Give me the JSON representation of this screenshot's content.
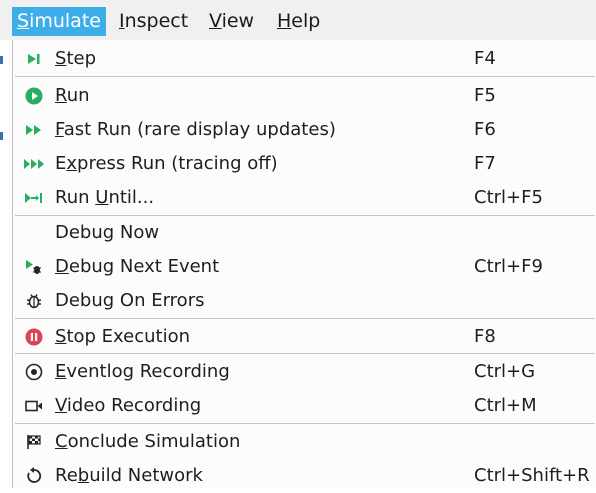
{
  "menubar": [
    {
      "label": "Simulate",
      "mnemonic_index": 0,
      "active": true
    },
    {
      "label": "Inspect",
      "mnemonic_index": 0,
      "active": false
    },
    {
      "label": "View",
      "mnemonic_index": 0,
      "active": false
    },
    {
      "label": "Help",
      "mnemonic_index": 0,
      "active": false
    }
  ],
  "menu": {
    "items": [
      {
        "label": "Step",
        "mnemonic_index": 0,
        "shortcut": "F4",
        "icon": "step-icon"
      },
      {
        "label": "Run",
        "mnemonic_index": 0,
        "shortcut": "F5",
        "icon": "run-icon"
      },
      {
        "label": "Fast Run (rare display updates)",
        "mnemonic_index": 0,
        "shortcut": "F6",
        "icon": "fast-run-icon"
      },
      {
        "label": "Express Run (tracing off)",
        "mnemonic_index": 1,
        "shortcut": "F7",
        "icon": "express-run-icon"
      },
      {
        "label": "Run Until...",
        "mnemonic_index": 4,
        "shortcut": "Ctrl+F5",
        "icon": "run-until-icon"
      },
      {
        "label": "Debug Now",
        "mnemonic_index": -1,
        "shortcut": "",
        "icon": ""
      },
      {
        "label": "Debug Next Event",
        "mnemonic_index": 0,
        "shortcut": "Ctrl+F9",
        "icon": "debug-next-event-icon"
      },
      {
        "label": "Debug On Errors",
        "mnemonic_index": -1,
        "shortcut": "",
        "icon": "bug-icon"
      },
      {
        "label": "Stop Execution",
        "mnemonic_index": 0,
        "shortcut": "F8",
        "icon": "stop-icon"
      },
      {
        "label": "Eventlog Recording",
        "mnemonic_index": 0,
        "shortcut": "Ctrl+G",
        "icon": "record-icon"
      },
      {
        "label": "Video Recording",
        "mnemonic_index": 0,
        "shortcut": "Ctrl+M",
        "icon": "video-camera-icon"
      },
      {
        "label": "Conclude Simulation",
        "mnemonic_index": 0,
        "shortcut": "",
        "icon": "checkered-flag-icon"
      },
      {
        "label": "Rebuild Network",
        "mnemonic_index": 2,
        "shortcut": "Ctrl+Shift+R",
        "icon": "rebuild-icon"
      }
    ]
  },
  "colors": {
    "accent": "#3daee9",
    "run_green": "#27ae60",
    "stop_red": "#da4453",
    "icon_dark": "#232629"
  }
}
